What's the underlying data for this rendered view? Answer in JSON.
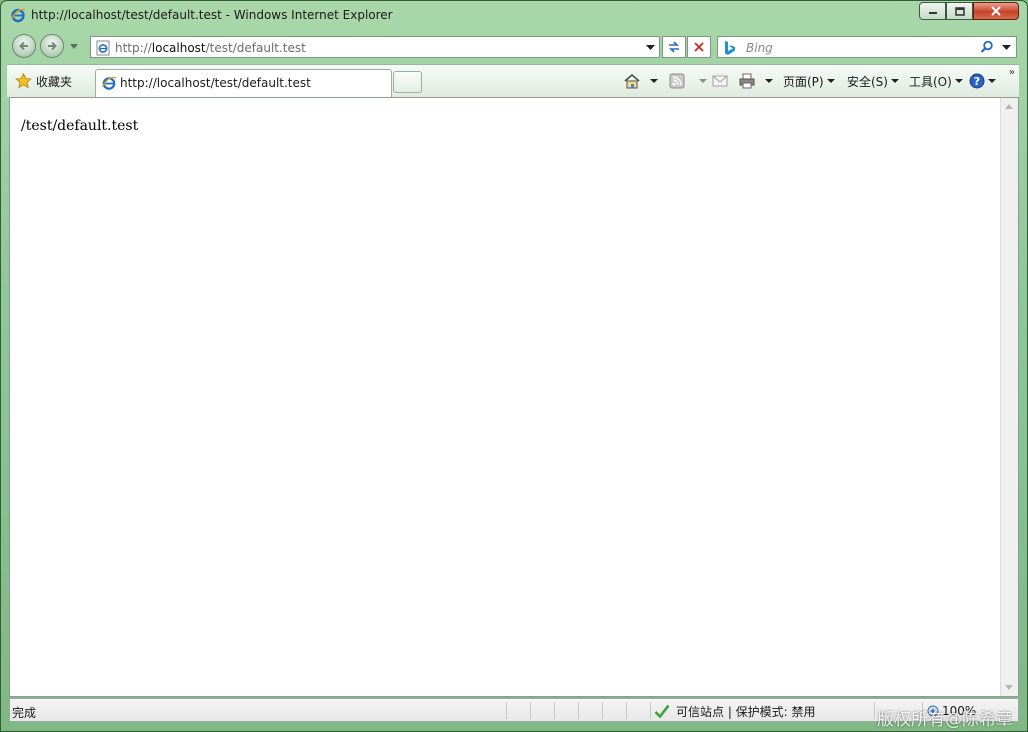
{
  "window": {
    "title": "http://localhost/test/default.test - Windows Internet Explorer"
  },
  "nav": {
    "address_prefix": "http://",
    "address_host": "localhost",
    "address_path": "/test/default.test",
    "search_placeholder": "Bing"
  },
  "favorites": {
    "label": "收藏夹"
  },
  "tab": {
    "title": "http://localhost/test/default.test"
  },
  "commands": {
    "page": "页面(P)",
    "safety": "安全(S)",
    "tools": "工具(O)"
  },
  "content": {
    "text": "/test/default.test"
  },
  "status": {
    "text": "完成",
    "zone": "可信站点 | 保护模式: 禁用",
    "zoom": "100%"
  },
  "watermark": "版权所有@陈希章",
  "colors": {
    "frame": "#8ec79a",
    "close_button": "#c7432a",
    "ie_blue": "#1f6fc4"
  }
}
